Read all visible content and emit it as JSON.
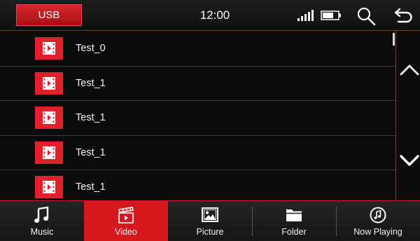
{
  "header": {
    "source_label": "USB",
    "clock": "12:00"
  },
  "colors": {
    "accent": "#d4191f",
    "background": "#0b0b0b",
    "divider": "#3a3a3a"
  },
  "list": {
    "items": [
      {
        "label": "Test_0",
        "icon": "video-file-icon"
      },
      {
        "label": "Test_1",
        "icon": "video-file-icon"
      },
      {
        "label": "Test_1",
        "icon": "video-file-icon"
      },
      {
        "label": "Test_1",
        "icon": "video-file-icon"
      },
      {
        "label": "Test_1",
        "icon": "video-file-icon"
      }
    ]
  },
  "tabs": [
    {
      "label": "Music",
      "icon": "music-note-icon",
      "active": false
    },
    {
      "label": "Video",
      "icon": "clapperboard-icon",
      "active": true
    },
    {
      "label": "Picture",
      "icon": "picture-icon",
      "active": false
    },
    {
      "label": "Folder",
      "icon": "folder-icon",
      "active": false
    },
    {
      "label": "Now Playing",
      "icon": "now-playing-icon",
      "active": false
    }
  ]
}
